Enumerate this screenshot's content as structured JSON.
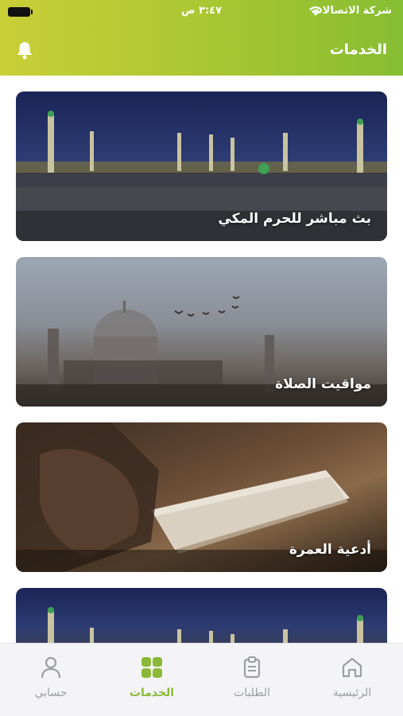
{
  "status_bar": {
    "carrier": "شركة الاتصالات",
    "time": "٣:٤٧ ص"
  },
  "header": {
    "title": "الخدمات",
    "icon": "bell-icon"
  },
  "cards": [
    {
      "label": "بث مباشر للحرم المكي",
      "image": "mosque-night-image"
    },
    {
      "label": "مواقيت الصلاة",
      "image": "mosque-dusk-image"
    },
    {
      "label": "أدعية العمرة",
      "image": "praying-hands-quran-image"
    },
    {
      "label": "",
      "image": "mosque-night-image"
    }
  ],
  "tabbar": {
    "items": [
      {
        "label": "الرئيسية",
        "icon": "home-icon",
        "active": false
      },
      {
        "label": "الطلبات",
        "icon": "clipboard-icon",
        "active": false
      },
      {
        "label": "الخدمات",
        "icon": "grid-icon",
        "active": true
      },
      {
        "label": "حسابي",
        "icon": "user-icon",
        "active": false
      }
    ]
  },
  "colors": {
    "header_gradient_start": "#c9cf36",
    "header_gradient_end": "#86bd33",
    "active_tab": "#8ab838",
    "inactive_tab": "#9b9ea4"
  }
}
